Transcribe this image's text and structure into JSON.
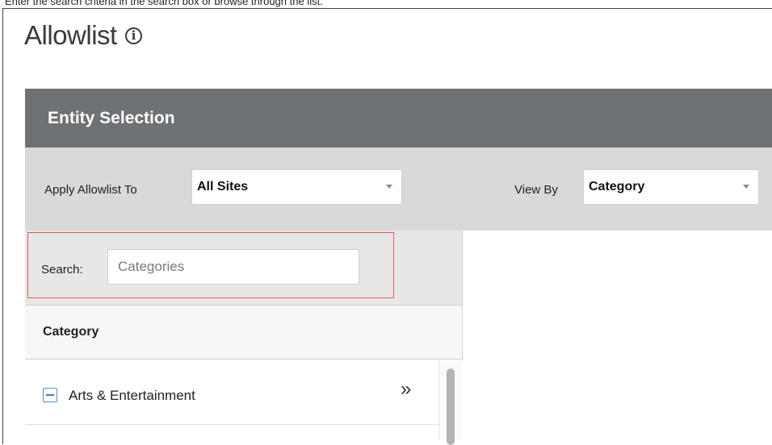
{
  "caption": "Enter the search criteria in the search box or browse through the list.",
  "page": {
    "title": "Allowlist",
    "info_icon": "info-icon"
  },
  "panel": {
    "header": "Entity Selection"
  },
  "toolbar": {
    "apply_label": "Apply Allowlist To",
    "apply_value": "All Sites",
    "view_label": "View By",
    "view_value": "Category"
  },
  "search": {
    "label": "Search:",
    "placeholder": "Categories",
    "value": ""
  },
  "list": {
    "column_header": "Category",
    "items": [
      {
        "label": "Arts & Entertainment",
        "state_icon": "collapse-icon",
        "action_icon": "double-chevron-right-icon"
      }
    ]
  },
  "colors": {
    "header_bg": "#6f7275",
    "toolbar_bg": "#d9d9d9",
    "highlight": "#e05a5a",
    "accent": "#2f7fd6"
  }
}
